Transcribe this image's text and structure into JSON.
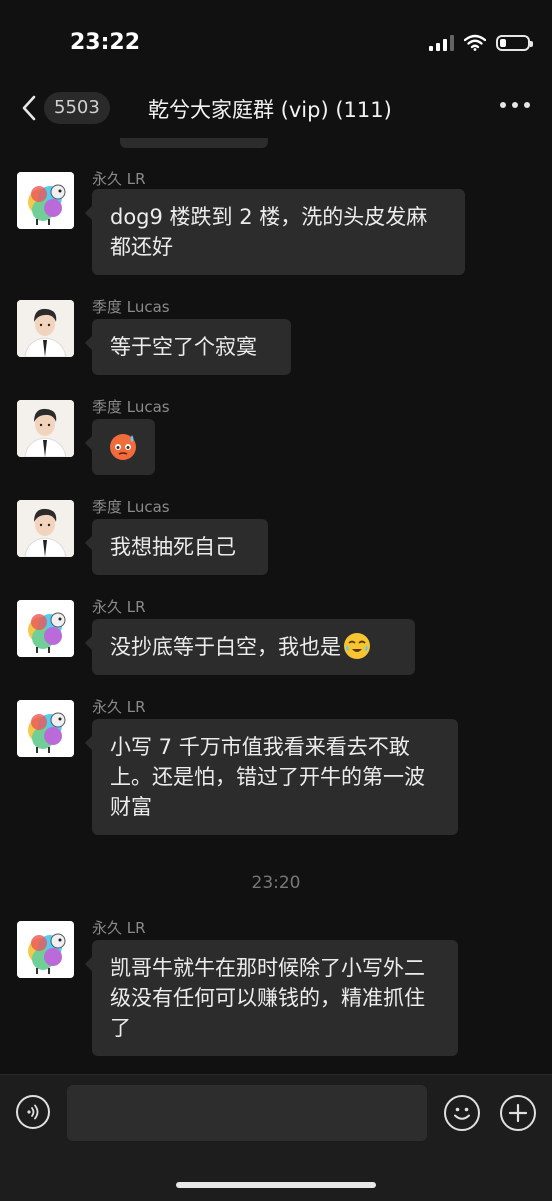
{
  "status": {
    "time": "23:22"
  },
  "nav": {
    "unread_count": "5503",
    "title": "乾兮大家庭群 (vip) (111)"
  },
  "messages": [
    {
      "sender": "永久 LR",
      "avatar": "sheep-avatar",
      "text": "dog9 楼跌到 2 楼，洗的头皮发麻都还好"
    },
    {
      "sender": "季度 Lucas",
      "avatar": "man-avatar",
      "text": "等于空了个寂寞"
    },
    {
      "sender": "季度 Lucas",
      "avatar": "man-avatar",
      "emoji": "anxious-sweat-emoji"
    },
    {
      "sender": "季度 Lucas",
      "avatar": "man-avatar",
      "text": "我想抽死自己"
    },
    {
      "sender": "永久 LR",
      "avatar": "sheep-avatar",
      "text": "没抄底等于白空，我也是",
      "trailing_emoji": "crying-laugh-emoji"
    },
    {
      "sender": "永久 LR",
      "avatar": "sheep-avatar",
      "text": "小写 7 千万市值我看来看去不敢上。还是怕，错过了开牛的第一波财富"
    },
    {
      "sender": "永久 LR",
      "avatar": "sheep-avatar",
      "text": "凯哥牛就牛在那时候除了小写外二级没有任何可以赚钱的，精准抓住了"
    }
  ],
  "time_separator": "23:20",
  "input": {
    "value": "",
    "placeholder": ""
  },
  "colors": {
    "background": "#111111",
    "bubble": "#2c2c2c",
    "input_bar": "#1d1d1d"
  }
}
